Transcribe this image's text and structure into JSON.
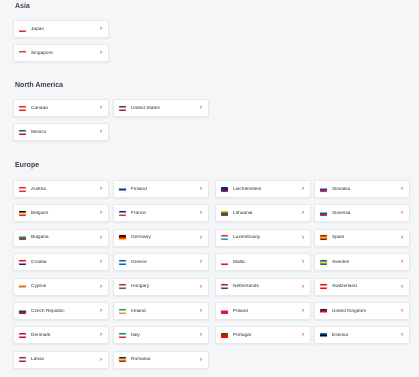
{
  "regions": [
    {
      "title": "Asia",
      "countries": [
        {
          "name": "Japan",
          "flag": [
            "#ffffff",
            "#ffffff",
            "#d7263d"
          ]
        },
        {
          "name": "Singapore",
          "flag": [
            "#e03a3e",
            "#ffffff",
            "#ffffff"
          ]
        }
      ]
    },
    {
      "title": "North America",
      "countries": [
        {
          "name": "Canada",
          "flag": [
            "#d52b1e",
            "#ffffff",
            "#d52b1e"
          ]
        },
        {
          "name": "United States",
          "flag": [
            "#3c3b6e",
            "#ffffff",
            "#b22234"
          ]
        },
        {
          "name": "Mexico",
          "flag": [
            "#006847",
            "#ffffff",
            "#ce1126"
          ]
        }
      ]
    },
    {
      "title": "Europe",
      "countries": [
        {
          "name": "Austria",
          "flag": [
            "#ed2939",
            "#ffffff",
            "#ed2939"
          ]
        },
        {
          "name": "Finland",
          "flag": [
            "#ffffff",
            "#003580",
            "#ffffff"
          ]
        },
        {
          "name": "Liechtenstein",
          "flag": [
            "#002b7f",
            "#002b7f",
            "#ce1126"
          ]
        },
        {
          "name": "Slovakia",
          "flag": [
            "#ffffff",
            "#0b4ea2",
            "#ee1c25"
          ]
        },
        {
          "name": "Belgium",
          "flag": [
            "#000000",
            "#fae042",
            "#ed2939"
          ]
        },
        {
          "name": "France",
          "flag": [
            "#002395",
            "#ffffff",
            "#ed2939"
          ]
        },
        {
          "name": "Lithuania",
          "flag": [
            "#fdb913",
            "#006a44",
            "#c1272d"
          ]
        },
        {
          "name": "Slovenia",
          "flag": [
            "#ffffff",
            "#005da4",
            "#ed1c24"
          ]
        },
        {
          "name": "Bulgaria",
          "flag": [
            "#ffffff",
            "#00966e",
            "#d62612"
          ]
        },
        {
          "name": "Germany",
          "flag": [
            "#000000",
            "#dd0000",
            "#ffce00"
          ]
        },
        {
          "name": "Luxembourg",
          "flag": [
            "#ed2939",
            "#ffffff",
            "#00a1de"
          ]
        },
        {
          "name": "Spain",
          "flag": [
            "#aa151b",
            "#f1bf00",
            "#aa151b"
          ]
        },
        {
          "name": "Croatia",
          "flag": [
            "#ff0000",
            "#ffffff",
            "#171796"
          ]
        },
        {
          "name": "Greece",
          "flag": [
            "#0d5eaf",
            "#ffffff",
            "#0d5eaf"
          ]
        },
        {
          "name": "Malta",
          "flag": [
            "#ffffff",
            "#ffffff",
            "#cf142b"
          ]
        },
        {
          "name": "Sweden",
          "flag": [
            "#006aa7",
            "#fecc00",
            "#006aa7"
          ]
        },
        {
          "name": "Cyprus",
          "flag": [
            "#ffffff",
            "#d57800",
            "#ffffff"
          ]
        },
        {
          "name": "Hungary",
          "flag": [
            "#ce2939",
            "#ffffff",
            "#477050"
          ]
        },
        {
          "name": "Netherlands",
          "flag": [
            "#ae1c28",
            "#ffffff",
            "#21468b"
          ]
        },
        {
          "name": "Switzerland",
          "flag": [
            "#ff0000",
            "#ffffff",
            "#ff0000"
          ]
        },
        {
          "name": "Czech Republic",
          "flag": [
            "#ffffff",
            "#11457e",
            "#d7141a"
          ]
        },
        {
          "name": "Ireland",
          "flag": [
            "#169b62",
            "#ffffff",
            "#ff883e"
          ]
        },
        {
          "name": "Poland",
          "flag": [
            "#ffffff",
            "#dc143c",
            "#dc143c"
          ]
        },
        {
          "name": "United Kingdom",
          "flag": [
            "#012169",
            "#c8102e",
            "#ffffff"
          ]
        },
        {
          "name": "Denmark",
          "flag": [
            "#c60c30",
            "#ffffff",
            "#c60c30"
          ]
        },
        {
          "name": "Italy",
          "flag": [
            "#009246",
            "#ffffff",
            "#ce2b37"
          ]
        },
        {
          "name": "Portugal",
          "flag": [
            "#006600",
            "#ff0000",
            "#ff0000"
          ]
        },
        {
          "name": "Estonia",
          "flag": [
            "#0072ce",
            "#000000",
            "#ffffff"
          ]
        },
        {
          "name": "Latvia",
          "flag": [
            "#9e3039",
            "#ffffff",
            "#9e3039"
          ]
        },
        {
          "name": "Romania",
          "flag": [
            "#002b7f",
            "#fcd116",
            "#ce1126"
          ]
        }
      ]
    }
  ],
  "chevron": "›",
  "colors": {
    "accent": "#e0242e",
    "background": "#f5f6f8",
    "card": "#ffffff"
  }
}
